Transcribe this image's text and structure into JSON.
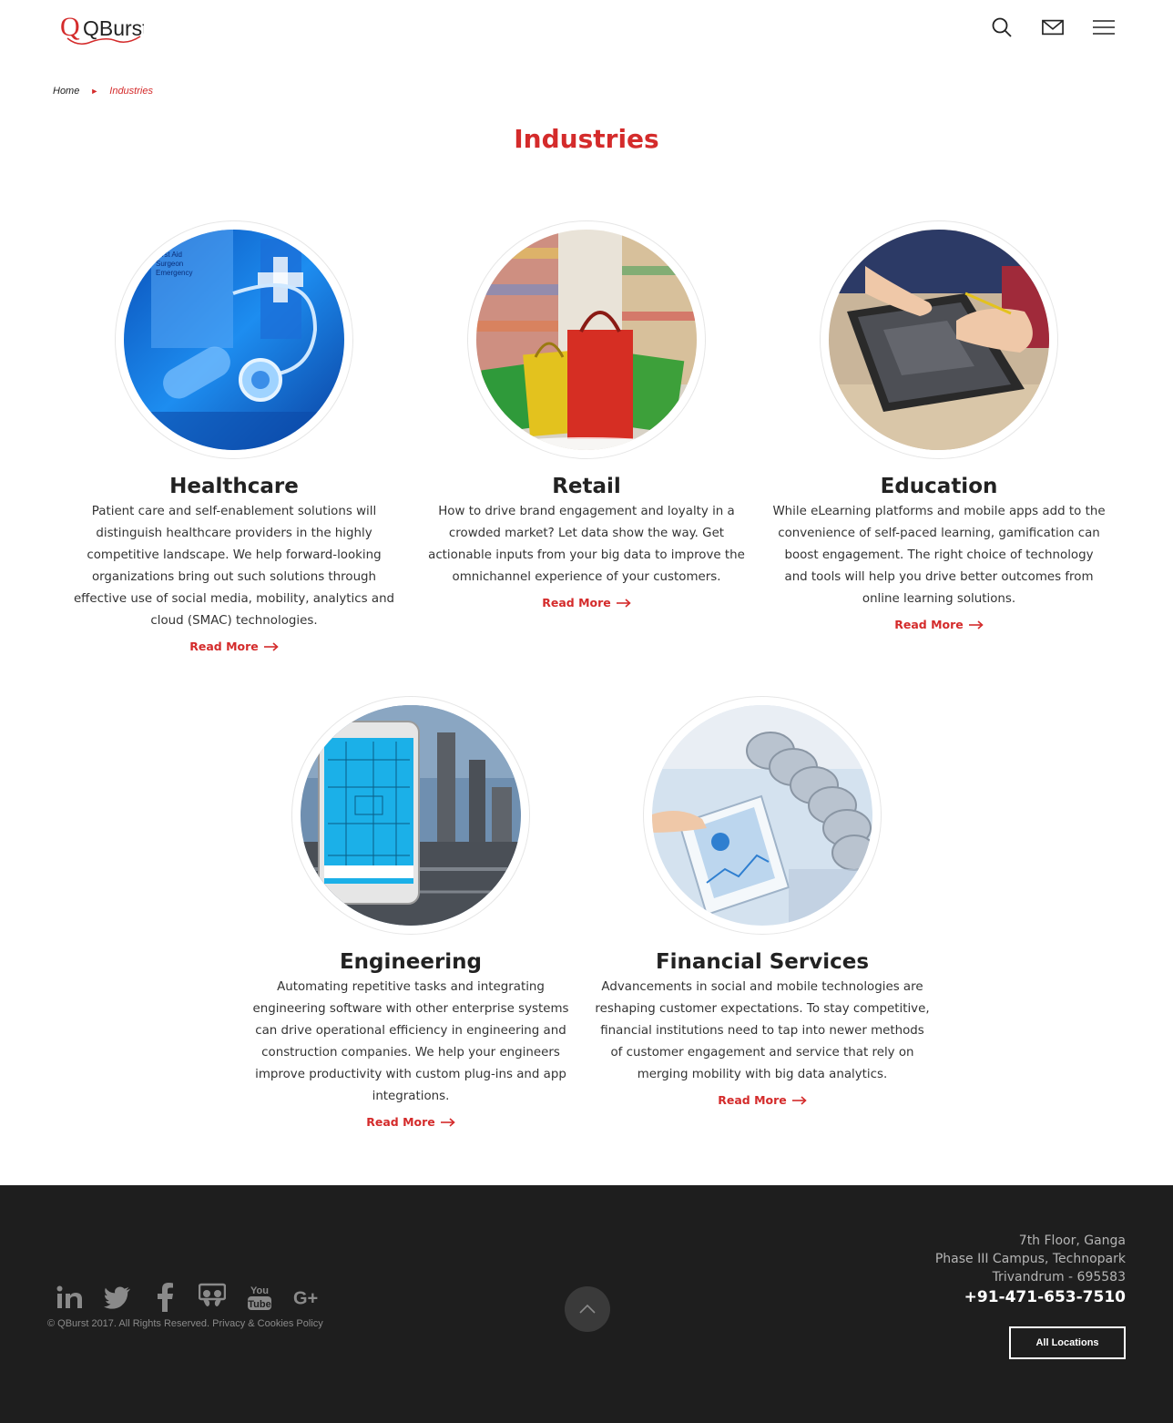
{
  "header": {
    "logo_text": "QBurst",
    "icons": [
      "search-icon",
      "mail-icon",
      "menu-icon"
    ]
  },
  "breadcrumb": {
    "home": "Home",
    "separator": "►",
    "current": "Industries"
  },
  "page_title": "Industries",
  "industries": [
    {
      "title": "Healthcare",
      "description": "Patient care and self-enablement solutions will distinguish healthcare providers in the highly competitive landscape. We help forward-looking organizations bring out such solutions through effective use of social media, mobility, analytics and cloud (SMAC) technologies.",
      "link": "Read More",
      "image_text": [
        "First Aid",
        "Surgeon",
        "Emergency"
      ]
    },
    {
      "title": "Retail",
      "description": "How to drive brand engagement and loyalty in a crowded market? Let data show the way. Get actionable inputs from your big data to improve the omnichannel experience of your customers.",
      "link": "Read More"
    },
    {
      "title": "Education",
      "description": "While eLearning platforms and mobile apps add to the convenience of self-paced learning, gamification can boost engagement. The right choice of technology and tools will help you drive better outcomes from online learning solutions.",
      "link": "Read More"
    },
    {
      "title": "Engineering",
      "description": "Automating repetitive tasks and integrating engineering software with other enterprise systems can drive operational efficiency in engineering and construction companies. We help your engineers improve productivity with custom plug-ins and app integrations.",
      "link": "Read More"
    },
    {
      "title": "Financial Services",
      "description": "Advancements in social and mobile technologies are reshaping customer expectations. To stay competitive, financial institutions need to tap into newer methods of customer engagement and service that rely on merging mobility with big data analytics.",
      "link": "Read More"
    }
  ],
  "footer": {
    "social": [
      "linkedin-icon",
      "twitter-icon",
      "facebook-icon",
      "slideshare-icon",
      "youtube-icon",
      "google-plus-icon"
    ],
    "copyright": "© QBurst 2017. All Rights Reserved. Privacy & Cookies Policy",
    "address_line1": "7th Floor, Ganga",
    "address_line2": "Phase III Campus, Technopark",
    "address_line3": "Trivandrum - 695583",
    "phone": "+91-471-653-7510",
    "all_locations": "All Locations"
  },
  "colors": {
    "accent": "#d42b2b",
    "footer_bg": "#1e1e1e",
    "text": "#333333"
  }
}
